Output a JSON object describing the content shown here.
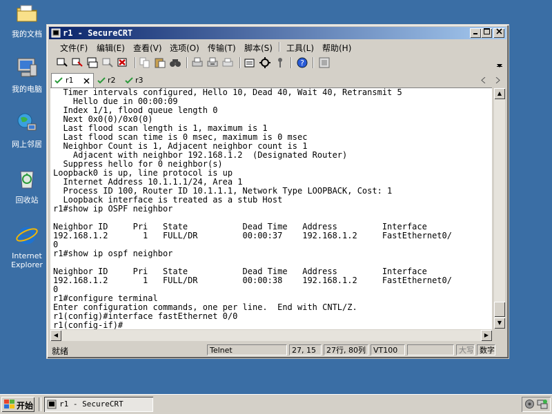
{
  "desktop": {
    "icons": [
      {
        "label": "我的文档",
        "icon": "folder-icon"
      },
      {
        "label": "我的电脑",
        "icon": "computer-icon"
      },
      {
        "label": "网上邻居",
        "icon": "network-icon"
      },
      {
        "label": "回收站",
        "icon": "recycle-bin-icon"
      },
      {
        "label": "Internet Explorer",
        "icon": "ie-icon"
      }
    ]
  },
  "window": {
    "title": "r1 - SecureCRT",
    "menu": [
      "文件(F)",
      "编辑(E)",
      "查看(V)",
      "选项(O)",
      "传输(T)",
      "脚本(S)",
      "工具(L)",
      "帮助(H)"
    ],
    "tabs": [
      {
        "label": "r1",
        "active": true
      },
      {
        "label": "r2",
        "active": false
      },
      {
        "label": "r3",
        "active": false
      }
    ],
    "terminal_lines": [
      "  Timer intervals configured, Hello 10, Dead 40, Wait 40, Retransmit 5",
      "    Hello due in 00:00:09",
      "  Index 1/1, flood queue length 0",
      "  Next 0x0(0)/0x0(0)",
      "  Last flood scan length is 1, maximum is 1",
      "  Last flood scan time is 0 msec, maximum is 0 msec",
      "  Neighbor Count is 1, Adjacent neighbor count is 1",
      "    Adjacent with neighbor 192.168.1.2  (Designated Router)",
      "  Suppress hello for 0 neighbor(s)",
      "Loopback0 is up, line protocol is up",
      "  Internet Address 10.1.1.1/24, Area 1",
      "  Process ID 100, Router ID 10.1.1.1, Network Type LOOPBACK, Cost: 1",
      "  Loopback interface is treated as a stub Host",
      "r1#show ip OSPF neighbor",
      "",
      "Neighbor ID     Pri   State           Dead Time   Address         Interface",
      "192.168.1.2       1   FULL/DR         00:00:37    192.168.1.2     FastEthernet0/",
      "0",
      "r1#show ip ospf neighbor",
      "",
      "Neighbor ID     Pri   State           Dead Time   Address         Interface",
      "192.168.1.2       1   FULL/DR         00:00:38    192.168.1.2     FastEthernet0/",
      "0",
      "r1#configure terminal",
      "Enter configuration commands, one per line.  End with CNTL/Z.",
      "r1(config)#interface fastEthernet 0/0",
      "r1(config-if)#"
    ],
    "status": {
      "ready": "就绪",
      "protocol": "Telnet",
      "cursor": "27, 15",
      "size": "27行, 80列",
      "terminal": "VT100",
      "empty": "",
      "caps": "大写",
      "num": "数字"
    }
  },
  "taskbar": {
    "start_label": "开始",
    "task_label": "r1 - SecureCRT"
  },
  "colors": {
    "desktop": "#3a6ea5",
    "title_start": "#0a246a",
    "title_end": "#a6caf0",
    "chrome": "#d4d0c8"
  }
}
